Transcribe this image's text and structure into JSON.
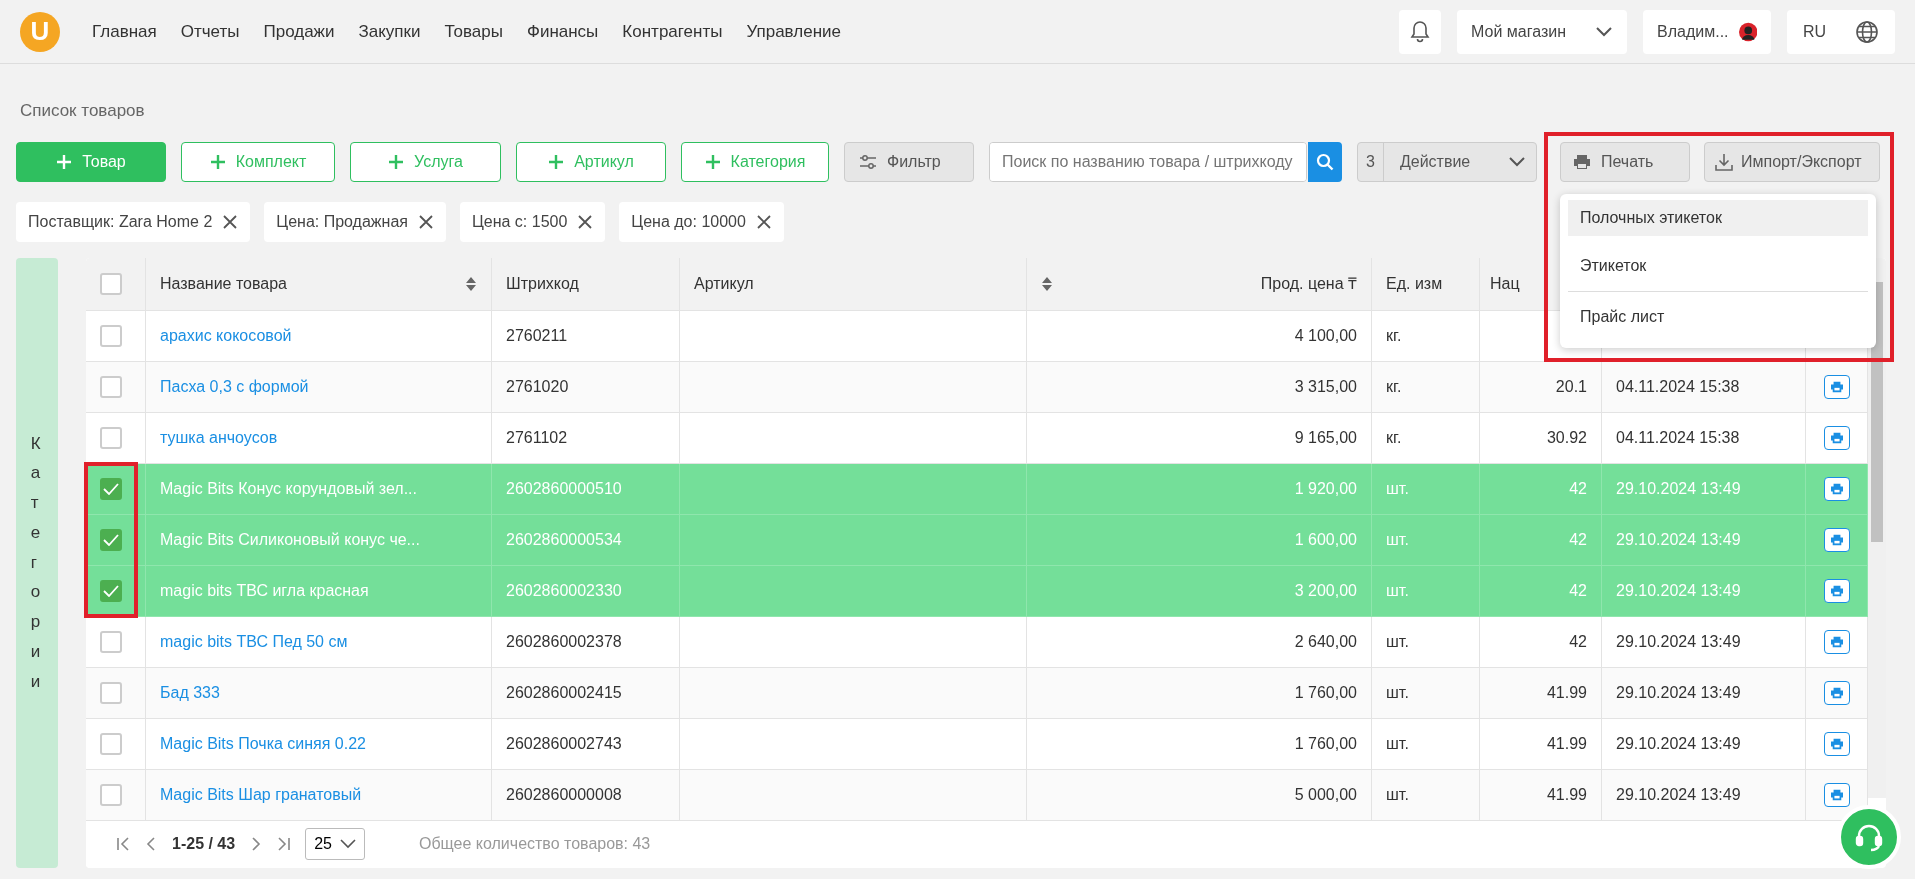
{
  "nav": {
    "logo": "U",
    "items": [
      "Главная",
      "Отчеты",
      "Продажи",
      "Закупки",
      "Товары",
      "Финансы",
      "Контрагенты",
      "Управление"
    ],
    "store": "Мой магазин",
    "user": "Владим...",
    "lang": "RU"
  },
  "page_title": "Список товаров",
  "toolbar": {
    "add_buttons": [
      {
        "label": "Товар",
        "kind": "primary"
      },
      {
        "label": "Комплект",
        "kind": "outline"
      },
      {
        "label": "Услуга",
        "kind": "outline"
      },
      {
        "label": "Артикул",
        "kind": "outline"
      },
      {
        "label": "Категория",
        "kind": "outline"
      }
    ],
    "filter": "Фильтр",
    "search": {
      "placeholder": "Поиск по названию товара / штрихкоду"
    },
    "selected_count": "3",
    "action": "Действие",
    "print": "Печать",
    "import_export": "Импорт/Экспорт",
    "print_menu": [
      {
        "label": "Полочных этикеток",
        "selected": true
      },
      {
        "label": "Этикеток",
        "selected": false
      },
      {
        "label": "Прайс лист",
        "selected": false
      }
    ]
  },
  "filters": [
    "Поставщик: Zara Home 2",
    "Цена: Продажная",
    "Цена с: 1500",
    "Цена до: 10000"
  ],
  "sidebar_tab": "Категории",
  "table": {
    "select_all_checked": false,
    "columns": [
      "Название товара",
      "Штрихкод",
      "Артикул",
      "Прод. цена ₸",
      "Ед. изм",
      "Нац"
    ],
    "rows": [
      {
        "checked": false,
        "name": "арахис кокосовой",
        "barcode": "2760211",
        "price": "4 100,00",
        "unit": "кг."
      },
      {
        "checked": false,
        "name": "Пасха 0,3 с формой",
        "barcode": "2761020",
        "price": "3 315,00",
        "unit": "кг.",
        "markup": "20.1",
        "date": "04.11.2024 15:38"
      },
      {
        "checked": false,
        "name": "тушка анчоусов",
        "barcode": "2761102",
        "price": "9 165,00",
        "unit": "кг.",
        "markup": "30.92",
        "date": "04.11.2024 15:38"
      },
      {
        "checked": true,
        "name": "Magic Bits Конус корундовый зел...",
        "barcode": "2602860000510",
        "price": "1 920,00",
        "unit": "шт.",
        "markup": "42",
        "date": "29.10.2024 13:49"
      },
      {
        "checked": true,
        "name": "Magic Bits Силиконовый конус че...",
        "barcode": "2602860000534",
        "price": "1 600,00",
        "unit": "шт.",
        "markup": "42",
        "date": "29.10.2024 13:49"
      },
      {
        "checked": true,
        "name": "magic bits ТВС игла красная",
        "barcode": "2602860002330",
        "price": "3 200,00",
        "unit": "шт.",
        "markup": "42",
        "date": "29.10.2024 13:49"
      },
      {
        "checked": false,
        "name": "magic bits ТВС Пед 50 см",
        "barcode": "2602860002378",
        "price": "2 640,00",
        "unit": "шт.",
        "markup": "42",
        "date": "29.10.2024 13:49"
      },
      {
        "checked": false,
        "name": "Бад 333",
        "barcode": "2602860002415",
        "price": "1 760,00",
        "unit": "шт.",
        "markup": "41.99",
        "date": "29.10.2024 13:49"
      },
      {
        "checked": false,
        "name": "Magic Bits Почка синяя 0.22",
        "barcode": "2602860002743",
        "price": "1 760,00",
        "unit": "шт.",
        "markup": "41.99",
        "date": "29.10.2024 13:49"
      },
      {
        "checked": false,
        "name": "Magic Bits Шар гранатовый",
        "barcode": "2602860000008",
        "price": "5 000,00",
        "unit": "шт.",
        "markup": "41.99",
        "date": "29.10.2024 13:49"
      }
    ]
  },
  "pagination": {
    "range": "1-25 / 43",
    "page_size": "25",
    "total": "Общее количество товаров: 43"
  }
}
